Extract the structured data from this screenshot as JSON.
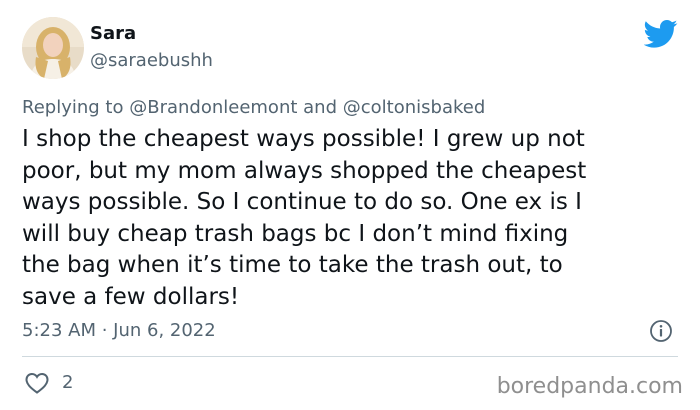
{
  "user": {
    "display_name": "Sara",
    "handle": "@saraebushh",
    "avatar_icon": "profile-photo"
  },
  "logo": {
    "icon": "twitter-bird-icon",
    "color": "#1d9bf0"
  },
  "replying": {
    "prefix": "Replying to",
    "mention_1": "@Brandonleemont",
    "conjunction": "and",
    "mention_2": "@coltonisbaked"
  },
  "tweet": {
    "lines": [
      "I shop the cheapest ways possible! I grew up not",
      "poor, but my mom always shopped the cheapest",
      "ways possible. So I continue to do so. One ex is I",
      "will buy cheap trash bags bc I don’t mind fixing",
      "the bag when it’s time to take the trash out, to",
      "save a few dollars!"
    ],
    "timestamp": "5:23 AM · Jun 6, 2022",
    "info_icon": "info-icon"
  },
  "engagement": {
    "like_icon": "heart-icon",
    "like_count": "2"
  },
  "watermark": "boredpanda.com"
}
